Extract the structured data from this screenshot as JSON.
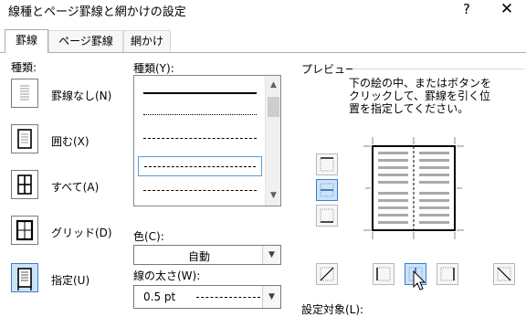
{
  "window": {
    "title": "線種とページ罫線と網かけの設定",
    "help_glyph": "?",
    "close_glyph": "✕"
  },
  "tabs": [
    {
      "label": "罫線",
      "active": true
    },
    {
      "label": "ページ罫線",
      "active": false
    },
    {
      "label": "網かけ",
      "active": false
    }
  ],
  "kind": {
    "label": "種類:",
    "items": [
      {
        "label": "罫線なし(N)",
        "icon": "no-border-icon"
      },
      {
        "label": "囲む(X)",
        "icon": "box-border-icon"
      },
      {
        "label": "すべて(A)",
        "icon": "all-borders-icon"
      },
      {
        "label": "グリッド(D)",
        "icon": "grid-border-icon"
      },
      {
        "label": "指定(U)",
        "icon": "custom-border-icon",
        "selected": true
      }
    ]
  },
  "style": {
    "label": "種類(Y):",
    "options": [
      "solid",
      "dotted",
      "dashed-small",
      "dashed",
      "dash-dot"
    ],
    "selected_index": 3
  },
  "color": {
    "label": "色(C):",
    "value": "自動"
  },
  "width": {
    "label": "線の太さ(W):",
    "value": "0.5 pt"
  },
  "preview": {
    "label": "プレビュー",
    "instructions": [
      "下の絵の中、またはボタンを",
      "クリックして、罫線を引く位",
      "置を指定してください。"
    ]
  },
  "apply_to": {
    "label": "設定対象(L):"
  },
  "colors": {
    "accent": "#3b7bd6",
    "selected_bg": "#cce4f7"
  }
}
